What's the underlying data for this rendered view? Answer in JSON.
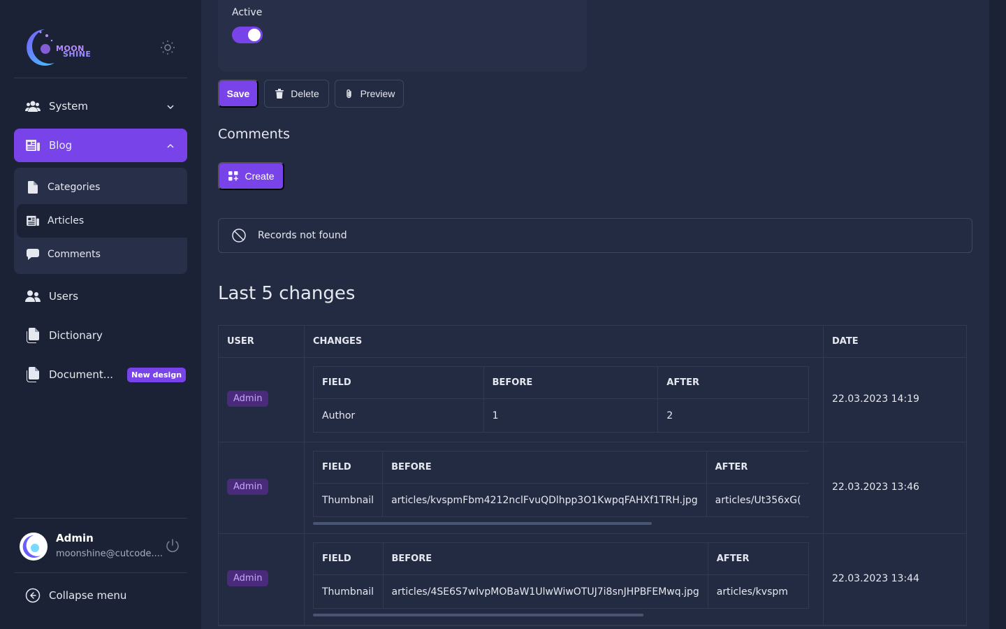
{
  "sidebar": {
    "logo": {
      "line1": "MOON",
      "line2": "SHINE"
    },
    "menu": {
      "system": "System",
      "blog": "Blog",
      "categories": "Categories",
      "articles": "Articles",
      "comments": "Comments",
      "users": "Users",
      "dictionary": "Dictionary",
      "documentation": "Document...",
      "documentation_badge": "New design"
    },
    "user": {
      "name": "Admin",
      "email": "moonshine@cutcode...."
    },
    "collapse": "Collapse menu"
  },
  "form": {
    "active_label": "Active",
    "active_on": true,
    "save": "Save",
    "delete": "Delete",
    "preview": "Preview"
  },
  "comments": {
    "title": "Comments",
    "create": "Create",
    "empty": "Records not found"
  },
  "history": {
    "title": "Last 5 changes",
    "headers": {
      "user": "USER",
      "changes": "CHANGES",
      "date": "DATE"
    },
    "inner_headers": {
      "field": "FIELD",
      "before": "BEFORE",
      "after": "AFTER"
    },
    "rows": [
      {
        "user": "Admin",
        "field": "Author",
        "before": "1",
        "after": "2",
        "date": "22.03.2023 14:19"
      },
      {
        "user": "Admin",
        "field": "Thumbnail",
        "before": "articles/kvspmFbm4212nclFvuQDlhpp3O1KwpqFAHXf1TRH.jpg",
        "after": "articles/Ut356xG(",
        "date": "22.03.2023 13:46"
      },
      {
        "user": "Admin",
        "field": "Thumbnail",
        "before": "articles/4SE6S7wlvpMOBaW1UlwWiwOTUJ7i8snJHPBFEMwq.jpg",
        "after": "articles/kvspm",
        "date": "22.03.2023 13:44"
      }
    ]
  },
  "colors": {
    "accent": "#7843e9",
    "bg": "#1b2235",
    "panel": "#232b43"
  },
  "icons": {
    "theme": "sun-icon",
    "system": "users-group-icon",
    "blog": "newspaper-icon",
    "categories": "document-icon",
    "articles": "newspaper-icon",
    "comments": "chat-bubble-icon",
    "users": "users-icon",
    "dictionary": "documents-icon",
    "documentation": "documents-icon",
    "logout": "power-icon",
    "collapse": "arrow-left-circle-icon",
    "delete": "trash-icon",
    "preview": "paperclip-icon",
    "create": "squares-plus-icon",
    "empty": "no-symbol-icon"
  }
}
